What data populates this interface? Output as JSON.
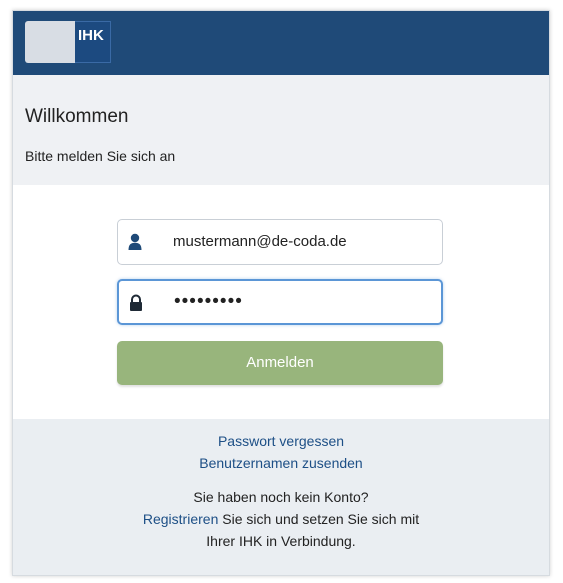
{
  "header": {
    "logo_text": "IHK"
  },
  "welcome": {
    "title": "Willkommen",
    "subtitle": "Bitte melden Sie sich an"
  },
  "form": {
    "username_value": "mustermann@de-coda.de",
    "password_value": "•••••••••",
    "login_label": "Anmelden"
  },
  "footer": {
    "forgot_password": "Passwort vergessen",
    "send_username": "Benutzernamen zusenden",
    "no_account": "Sie haben noch kein Konto?",
    "register_link": "Registrieren",
    "register_text": " Sie sich und setzen Sie sich mit",
    "register_text2": "Ihrer IHK in Verbindung."
  },
  "colors": {
    "header_bg": "#1f4a78",
    "welcome_bg": "#eff1f4",
    "footer_bg": "#eaeef2",
    "button_bg": "#98b57c",
    "link": "#1d4f86",
    "focus_border": "#5b96d6"
  },
  "icons": {
    "user": "user-icon",
    "lock": "lock-icon"
  }
}
